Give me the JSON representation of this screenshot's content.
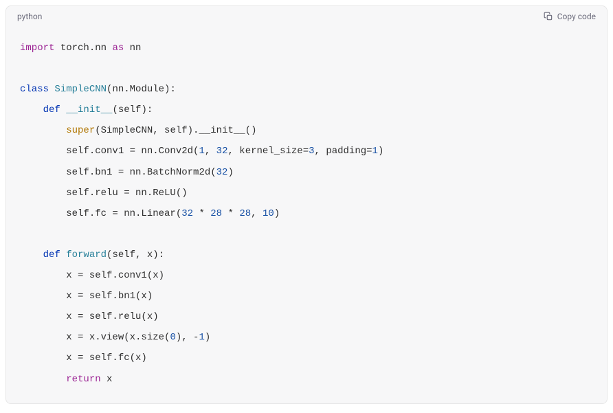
{
  "header": {
    "language": "python",
    "copy_label": "Copy code"
  },
  "code": {
    "tokens": [
      [
        {
          "t": "import ",
          "c": "tok-import"
        },
        {
          "t": "torch.nn ",
          "c": "tok-text"
        },
        {
          "t": "as",
          "c": "tok-import"
        },
        {
          "t": " nn",
          "c": "tok-text"
        }
      ],
      [],
      [
        {
          "t": "class ",
          "c": "tok-keyword"
        },
        {
          "t": "SimpleCNN",
          "c": "tok-classname"
        },
        {
          "t": "(nn.Module):",
          "c": "tok-text"
        }
      ],
      [
        {
          "t": "    ",
          "c": "tok-text"
        },
        {
          "t": "def ",
          "c": "tok-keyword"
        },
        {
          "t": "__init__",
          "c": "tok-funcname"
        },
        {
          "t": "(",
          "c": "tok-punct"
        },
        {
          "t": "self",
          "c": "tok-param"
        },
        {
          "t": "):",
          "c": "tok-punct"
        }
      ],
      [
        {
          "t": "        ",
          "c": "tok-text"
        },
        {
          "t": "super",
          "c": "tok-builtin"
        },
        {
          "t": "(SimpleCNN, self).__init__()",
          "c": "tok-text"
        }
      ],
      [
        {
          "t": "        self.conv1 = nn.Conv2d(",
          "c": "tok-text"
        },
        {
          "t": "1",
          "c": "tok-number"
        },
        {
          "t": ", ",
          "c": "tok-text"
        },
        {
          "t": "32",
          "c": "tok-number"
        },
        {
          "t": ", kernel_size=",
          "c": "tok-text"
        },
        {
          "t": "3",
          "c": "tok-number"
        },
        {
          "t": ", padding=",
          "c": "tok-text"
        },
        {
          "t": "1",
          "c": "tok-number"
        },
        {
          "t": ")",
          "c": "tok-text"
        }
      ],
      [
        {
          "t": "        self.bn1 = nn.BatchNorm2d(",
          "c": "tok-text"
        },
        {
          "t": "32",
          "c": "tok-number"
        },
        {
          "t": ")",
          "c": "tok-text"
        }
      ],
      [
        {
          "t": "        self.relu = nn.ReLU()",
          "c": "tok-text"
        }
      ],
      [
        {
          "t": "        self.fc = nn.Linear(",
          "c": "tok-text"
        },
        {
          "t": "32",
          "c": "tok-number"
        },
        {
          "t": " * ",
          "c": "tok-text"
        },
        {
          "t": "28",
          "c": "tok-number"
        },
        {
          "t": " * ",
          "c": "tok-text"
        },
        {
          "t": "28",
          "c": "tok-number"
        },
        {
          "t": ", ",
          "c": "tok-text"
        },
        {
          "t": "10",
          "c": "tok-number"
        },
        {
          "t": ")",
          "c": "tok-text"
        }
      ],
      [],
      [
        {
          "t": "    ",
          "c": "tok-text"
        },
        {
          "t": "def ",
          "c": "tok-keyword"
        },
        {
          "t": "forward",
          "c": "tok-funcname"
        },
        {
          "t": "(",
          "c": "tok-punct"
        },
        {
          "t": "self, x",
          "c": "tok-param"
        },
        {
          "t": "):",
          "c": "tok-punct"
        }
      ],
      [
        {
          "t": "        x = self.conv1(x)",
          "c": "tok-text"
        }
      ],
      [
        {
          "t": "        x = self.bn1(x)",
          "c": "tok-text"
        }
      ],
      [
        {
          "t": "        x = self.relu(x)",
          "c": "tok-text"
        }
      ],
      [
        {
          "t": "        x = x.view(x.size(",
          "c": "tok-text"
        },
        {
          "t": "0",
          "c": "tok-number"
        },
        {
          "t": "), -",
          "c": "tok-text"
        },
        {
          "t": "1",
          "c": "tok-number"
        },
        {
          "t": ")",
          "c": "tok-text"
        }
      ],
      [
        {
          "t": "        x = self.fc(x)",
          "c": "tok-text"
        }
      ],
      [
        {
          "t": "        ",
          "c": "tok-text"
        },
        {
          "t": "return",
          "c": "tok-return"
        },
        {
          "t": " x",
          "c": "tok-text"
        }
      ]
    ]
  }
}
